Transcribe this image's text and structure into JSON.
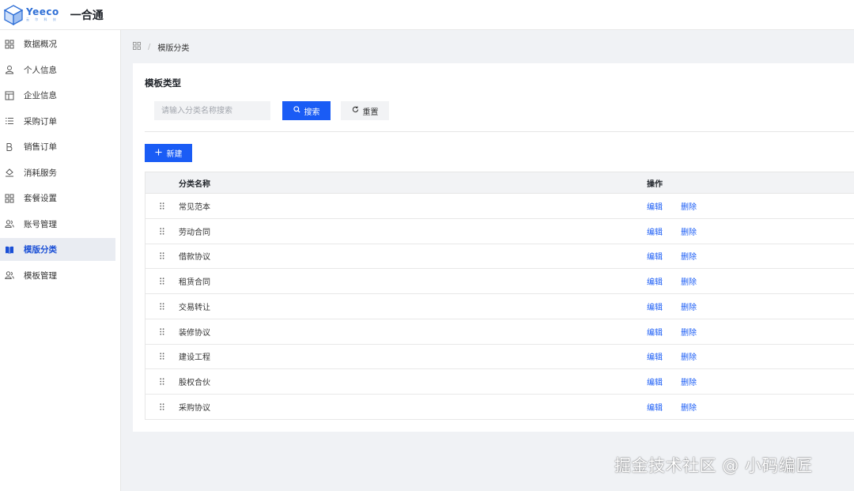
{
  "header": {
    "logo_word": "Yeeco",
    "logo_sub": "云 尔 科 技",
    "app_title": "一合通"
  },
  "sidebar": {
    "items": [
      {
        "label": "数据概况",
        "icon": "dashboard-grid-icon",
        "active": false
      },
      {
        "label": "个人信息",
        "icon": "user-icon",
        "active": false
      },
      {
        "label": "企业信息",
        "icon": "layout-icon",
        "active": false
      },
      {
        "label": "采购订单",
        "icon": "list-icon",
        "active": false
      },
      {
        "label": "销售订单",
        "icon": "bold-b-icon",
        "active": false
      },
      {
        "label": "消耗服务",
        "icon": "fill-bucket-icon",
        "active": false
      },
      {
        "label": "套餐设置",
        "icon": "apps-grid-icon",
        "active": false
      },
      {
        "label": "账号管理",
        "icon": "users-icon",
        "active": false
      },
      {
        "label": "模版分类",
        "icon": "book-icon",
        "active": true
      },
      {
        "label": "模板管理",
        "icon": "users-icon",
        "active": false
      }
    ]
  },
  "breadcrumb": {
    "current": "模版分类"
  },
  "main": {
    "section_title": "模板类型",
    "search": {
      "placeholder": "请输入分类名称搜索",
      "value": ""
    },
    "search_button": "搜索",
    "reset_button": "重置",
    "new_button": "新建",
    "table": {
      "headers": {
        "name": "分类名称",
        "ops": "操作"
      },
      "rows": [
        {
          "name": "常见范本",
          "edit": "编辑",
          "delete": "删除"
        },
        {
          "name": "劳动合同",
          "edit": "编辑",
          "delete": "删除"
        },
        {
          "name": "借款协议",
          "edit": "编辑",
          "delete": "删除"
        },
        {
          "name": "租赁合同",
          "edit": "编辑",
          "delete": "删除"
        },
        {
          "name": "交易转让",
          "edit": "编辑",
          "delete": "删除"
        },
        {
          "name": "装修协议",
          "edit": "编辑",
          "delete": "删除"
        },
        {
          "name": "建设工程",
          "edit": "编辑",
          "delete": "删除"
        },
        {
          "name": "股权合伙",
          "edit": "编辑",
          "delete": "删除"
        },
        {
          "name": "采购协议",
          "edit": "编辑",
          "delete": "删除"
        }
      ]
    }
  },
  "watermark": "掘金技术社区 @ 小码编匠",
  "colors": {
    "accent": "#1a5cf5",
    "active_bg": "#e9ecf2"
  }
}
